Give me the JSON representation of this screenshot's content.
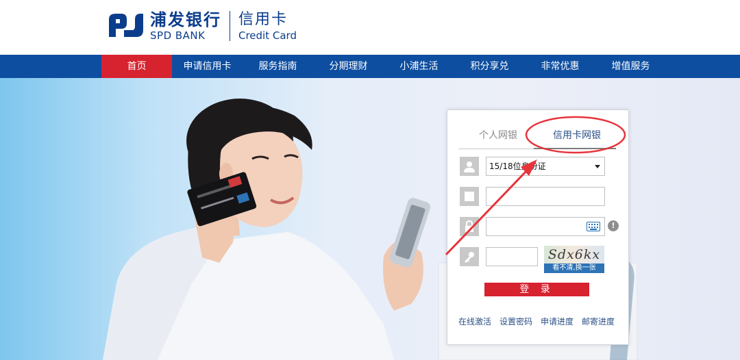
{
  "header": {
    "brand_cn": "浦发银行",
    "brand_en": "SPD BANK",
    "product_cn": "信用卡",
    "product_en": "Credit Card"
  },
  "nav": {
    "items": [
      {
        "label": "首页",
        "active": true
      },
      {
        "label": "申请信用卡"
      },
      {
        "label": "服务指南"
      },
      {
        "label": "分期理财"
      },
      {
        "label": "小浦生活"
      },
      {
        "label": "积分享兑"
      },
      {
        "label": "非常优惠"
      },
      {
        "label": "增值服务"
      }
    ]
  },
  "login": {
    "tabs": [
      "个人网银",
      "信用卡网银"
    ],
    "active_tab": 1,
    "id_type_selected": "15/18位身份证",
    "captcha_text": "Sdx6kx",
    "captcha_refresh": "看不清,换一张",
    "submit_label": "登 录",
    "links": [
      "在线激活",
      "设置密码",
      "申请进度",
      "邮寄进度"
    ]
  },
  "colors": {
    "brand_blue": "#0d4ea0",
    "accent_red": "#d7222f",
    "annotation_red": "#e8333a"
  }
}
